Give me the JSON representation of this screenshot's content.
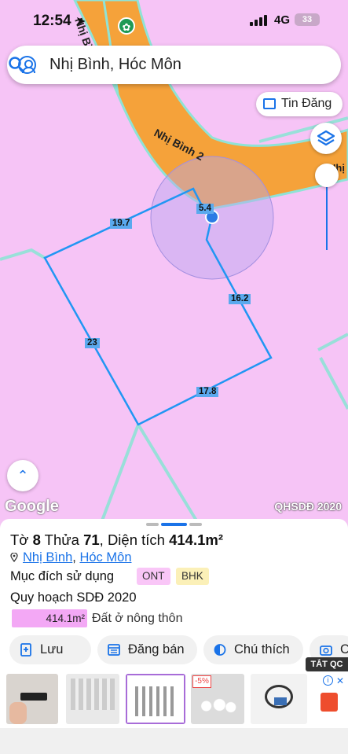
{
  "status_bar": {
    "time": "12:54",
    "network": "4G",
    "battery": "33"
  },
  "search": {
    "query": "Nhị Bình, Hóc Môn"
  },
  "map": {
    "road_label": "Nhị Bình 2",
    "edge_label": "Nhị",
    "parcel_edges": [
      "19.7",
      "5.4",
      "16.2",
      "23",
      "17.8"
    ],
    "attribution": "Google",
    "layer_label": "QHSDĐ 2020"
  },
  "toolbar": {
    "tin_dang": "Tin Đăng"
  },
  "sheet": {
    "title_prefix": "Tờ ",
    "to_num": "8",
    "thua_label": " Thửa ",
    "thua_num": "71",
    "area_label": ", Diện tích ",
    "area_value": "414.1m²",
    "ward": "Nhị Bình",
    "district": "Hóc Môn",
    "purpose_label": "Mục đích sử dụng",
    "badge_ont": "ONT",
    "badge_bhk": "BHK",
    "plan_label": "Quy hoạch SDĐ 2020",
    "legend_area": "414.1m²",
    "legend_desc": "Đất ở nông thôn",
    "actions": [
      "Lưu",
      "Đăng bán",
      "Chú thích",
      "C"
    ]
  },
  "ads": {
    "close_label": "TẮT QC",
    "discount": "-5%"
  },
  "colors": {
    "accent": "#1a73e8",
    "road": "#f5a23a",
    "parcel": "#f6c4f6",
    "ont": "#f3a8f5"
  }
}
